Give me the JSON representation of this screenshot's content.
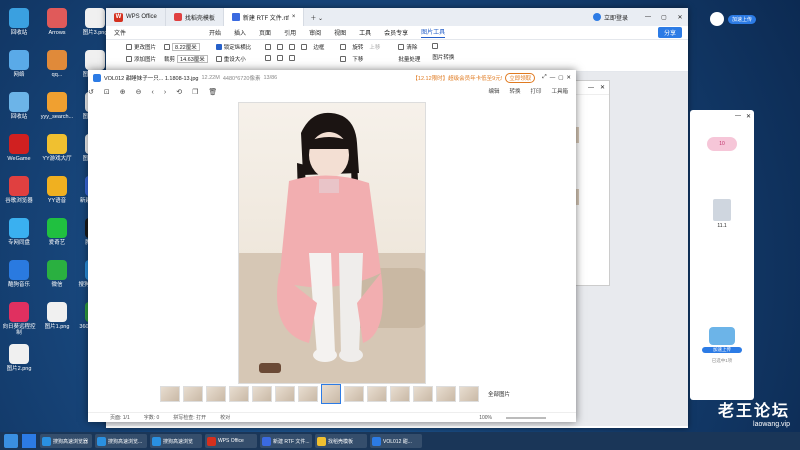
{
  "desktop": {
    "icons": [
      {
        "label": "回收站",
        "color": "#3aa0e0"
      },
      {
        "label": "Arrows",
        "color": "#e05a5a"
      },
      {
        "label": "图片3.png",
        "color": "#f0f0f0"
      },
      {
        "label": "网络",
        "color": "#5aaae8"
      },
      {
        "label": "qq...",
        "color": "#e08a3a"
      },
      {
        "label": "图片4.png",
        "color": "#f0f0f0"
      },
      {
        "label": "回收站",
        "color": "#6cb4e8"
      },
      {
        "label": "yyy_search...",
        "color": "#f0a030"
      },
      {
        "label": "图片5.png",
        "color": "#f0f0f0"
      },
      {
        "label": "WeGame",
        "color": "#d02020"
      },
      {
        "label": "YY游戏大厅",
        "color": "#f0c030"
      },
      {
        "label": "图片6.png",
        "color": "#f0f0f0"
      },
      {
        "label": "谷歌浏览器",
        "color": "#e04040"
      },
      {
        "label": "YY语音",
        "color": "#f0b020"
      },
      {
        "label": "新建 RTF 文件.rtf",
        "color": "#3a6ae0"
      },
      {
        "label": "专网同盘",
        "color": "#3ab0f0"
      },
      {
        "label": "爱奇艺",
        "color": "#20c040"
      },
      {
        "label": "腾讯QQ",
        "color": "#1a1a1a"
      },
      {
        "label": "酷狗音乐",
        "color": "#2a7ae0"
      },
      {
        "label": "微信",
        "color": "#2ab040"
      },
      {
        "label": "搜狗高速浏览器",
        "color": "#2a90e0"
      },
      {
        "label": "向日葵远程控制",
        "color": "#e03060"
      },
      {
        "label": "图片1.png",
        "color": "#f0f0f0"
      },
      {
        "label": "360安全浏览器",
        "color": "#30a040"
      },
      {
        "label": "图片2.png",
        "color": "#f0f0f0"
      }
    ]
  },
  "wps": {
    "tabs": [
      {
        "label": "WPS Office"
      },
      {
        "label": "找稻壳模板"
      },
      {
        "label": "新建 RTF 文件.rtf"
      }
    ],
    "login": "立即登录",
    "share": "分享",
    "menu": [
      "文件",
      "开始",
      "插入",
      "页面",
      "引用",
      "审阅",
      "视图",
      "工具",
      "会员专享",
      "图片工具"
    ],
    "ribbon": {
      "change_pic": "更改图片",
      "add_pic": "添加图片",
      "height_val": "8.22厘米",
      "width_val": "14.63厘米",
      "crop": "裁剪",
      "lock_ratio": "锁定纵横比",
      "reset_size": "重设大小",
      "border": "边框",
      "rotate": "旋转",
      "up": "上移",
      "down": "下移",
      "batch": "批量处理",
      "convert": "图片转换",
      "clear": "清除"
    }
  },
  "viewer": {
    "title": "VOL012 甜睡妹子一只... 1.1808-13.jpg",
    "filesize": "12.22M",
    "dims": "4480*6720像素",
    "index": "13/86",
    "promo": "【12.12限时】超级会员年卡低至9元!",
    "promo_btn": "立即领取",
    "tools": {
      "edit": "编辑",
      "convert": "转换",
      "print": "打印",
      "toolbox": "工具箱"
    },
    "all_pics": "全部图片",
    "status": {
      "page": "页面: 1/1",
      "words": "字数: 0",
      "spell": "拼写检查: 打开",
      "proof": "校对"
    },
    "zoom": "100%"
  },
  "doc": {
    "card1": [
      "甜睡妹",
      "子...",
      "1.18GB)",
      "jpg"
    ],
    "card2": [
      "甜睡妹",
      "子...",
      "1.18GB)",
      "jpg"
    ]
  },
  "panel": {
    "badge": "10",
    "file_label": "11.1",
    "ok_label": "已选中1项",
    "cloud_btn": "加速上传"
  },
  "watermark": {
    "title": "老王论坛",
    "url": "laowang.vip"
  },
  "taskbar": [
    {
      "label": "搜狗高速浏览器",
      "color": "#2a90e0"
    },
    {
      "label": "搜狗高速浏览...",
      "color": "#2a90e0"
    },
    {
      "label": "搜狗高速浏览",
      "color": "#2a90e0"
    },
    {
      "label": "WPS Office",
      "color": "#d4301e"
    },
    {
      "label": "新建 RTF 文件...",
      "color": "#3a6ae0"
    },
    {
      "label": "找稻壳模板",
      "color": "#f0c030"
    },
    {
      "label": "VOL012 甜...",
      "color": "#2c7be5"
    }
  ]
}
